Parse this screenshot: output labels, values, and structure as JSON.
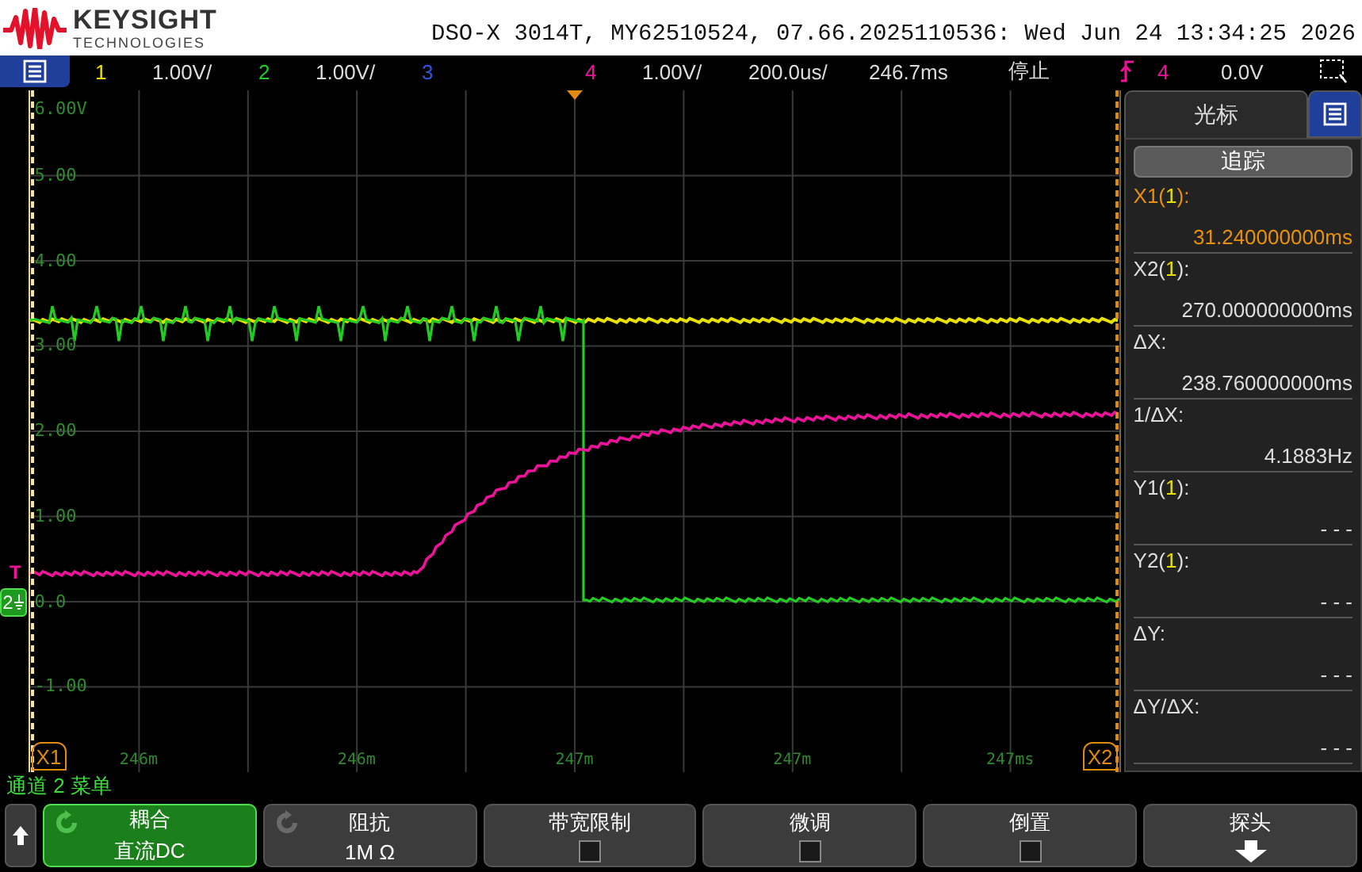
{
  "header": {
    "brand": "KEYSIGHT",
    "subbrand": "TECHNOLOGIES",
    "instrument_info": "DSO-X 3014T, MY62510524, 07.66.2025110536: Wed Jun 24 13:34:25 2026"
  },
  "channel_bar": {
    "channels": [
      {
        "number": "1",
        "scale": "1.00V/",
        "color": "#e8e000"
      },
      {
        "number": "2",
        "scale": "1.00V/",
        "color": "#22cc22"
      },
      {
        "number": "3",
        "color": "#3355dd"
      },
      {
        "number": "4",
        "scale": "1.00V/",
        "color": "#ee1199"
      }
    ],
    "timebase": "200.0us/",
    "delay": "246.7ms",
    "run_state": "停止",
    "trigger_source": "4",
    "trigger_level": "0.0V"
  },
  "graticule": {
    "y_labels": [
      "6.00V",
      "5.00",
      "4.00",
      "3.00",
      "2.00",
      "1.00",
      "0.0",
      "-1.00"
    ],
    "x_labels": [
      "246m",
      "246m",
      "247m",
      "247m",
      "247ms"
    ],
    "trigger_marker": "T",
    "ground_marker": "2",
    "cursor_labels": [
      "X1",
      "X2"
    ]
  },
  "cursor_panel": {
    "title": "光标",
    "track_button": "追踪",
    "readouts": [
      {
        "label": "X1(",
        "source": "1",
        "suffix": "):",
        "value": "31.240000000ms",
        "selected": true
      },
      {
        "label": "X2(",
        "source": "1",
        "suffix": "):",
        "value": "270.000000000ms",
        "selected": false
      },
      {
        "label": "ΔX:",
        "value": "238.760000000ms",
        "selected": false
      },
      {
        "label": "1/ΔX:",
        "value": "4.1883Hz",
        "selected": false
      },
      {
        "label": "Y1(",
        "source": "1",
        "suffix": "):",
        "value": "- - -",
        "selected": false
      },
      {
        "label": "Y2(",
        "source": "1",
        "suffix": "):",
        "value": "- - -",
        "selected": false
      },
      {
        "label": "ΔY:",
        "value": "- - -",
        "selected": false
      },
      {
        "label": "ΔY/ΔX:",
        "value": "- - -",
        "selected": false
      }
    ]
  },
  "menu_title": "通道 2 菜单",
  "softkeys": [
    {
      "kind": "value",
      "label": "耦合",
      "value": "直流DC",
      "selected": true
    },
    {
      "kind": "value",
      "label": "阻抗",
      "value": "1M Ω",
      "selected": false
    },
    {
      "kind": "checkbox",
      "label": "带宽限制",
      "checked": false
    },
    {
      "kind": "checkbox",
      "label": "微调",
      "checked": false
    },
    {
      "kind": "checkbox",
      "label": "倒置",
      "checked": false
    },
    {
      "kind": "submenu",
      "label": "探头"
    }
  ]
}
